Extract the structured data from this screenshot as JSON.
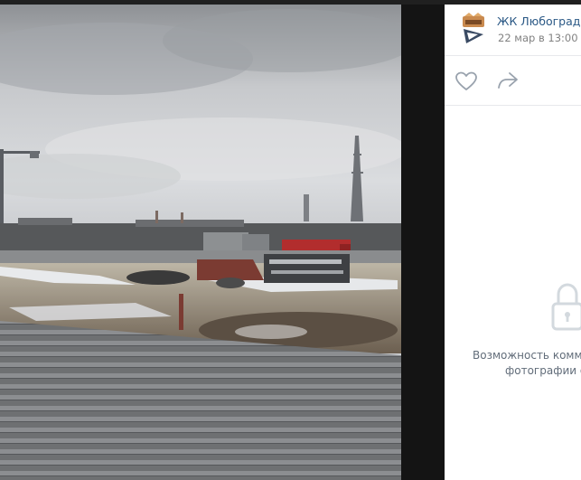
{
  "post": {
    "author_name": "ЖК Любоград",
    "date": "22 мар в 13:00"
  },
  "actions": {
    "like_icon": "heart-icon",
    "share_icon": "share-arrow-icon"
  },
  "comments": {
    "lock_icon": "lock-icon",
    "disabled_line1": "Возможность комме",
    "disabled_line2": "фотографии ог"
  },
  "colors": {
    "link": "#2a5885",
    "muted": "#828282",
    "icon": "#99a2ad",
    "lock": "#d3d9de"
  }
}
